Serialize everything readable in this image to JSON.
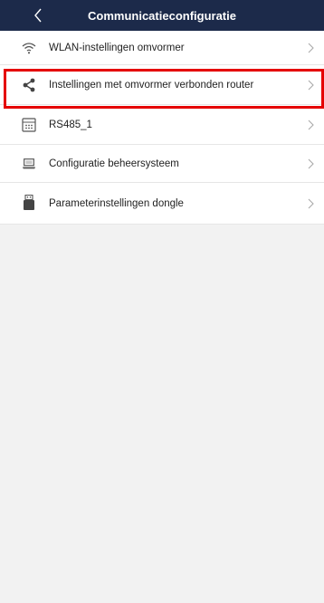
{
  "header": {
    "title": "Communicatieconfiguratie",
    "back_icon": "chevron-left-icon"
  },
  "items": [
    {
      "label": "WLAN-instellingen omvormer",
      "icon": "wifi-icon"
    },
    {
      "label": "Instellingen met omvormer verbonden router",
      "icon": "share-icon"
    },
    {
      "label": "RS485_1",
      "icon": "rs485-icon"
    },
    {
      "label": "Configuratie beheersysteem",
      "icon": "laptop-icon"
    },
    {
      "label": "Parameterinstellingen dongle",
      "icon": "dongle-icon"
    }
  ],
  "colors": {
    "header_bg": "#1c2a4a",
    "highlight": "#e50000"
  }
}
